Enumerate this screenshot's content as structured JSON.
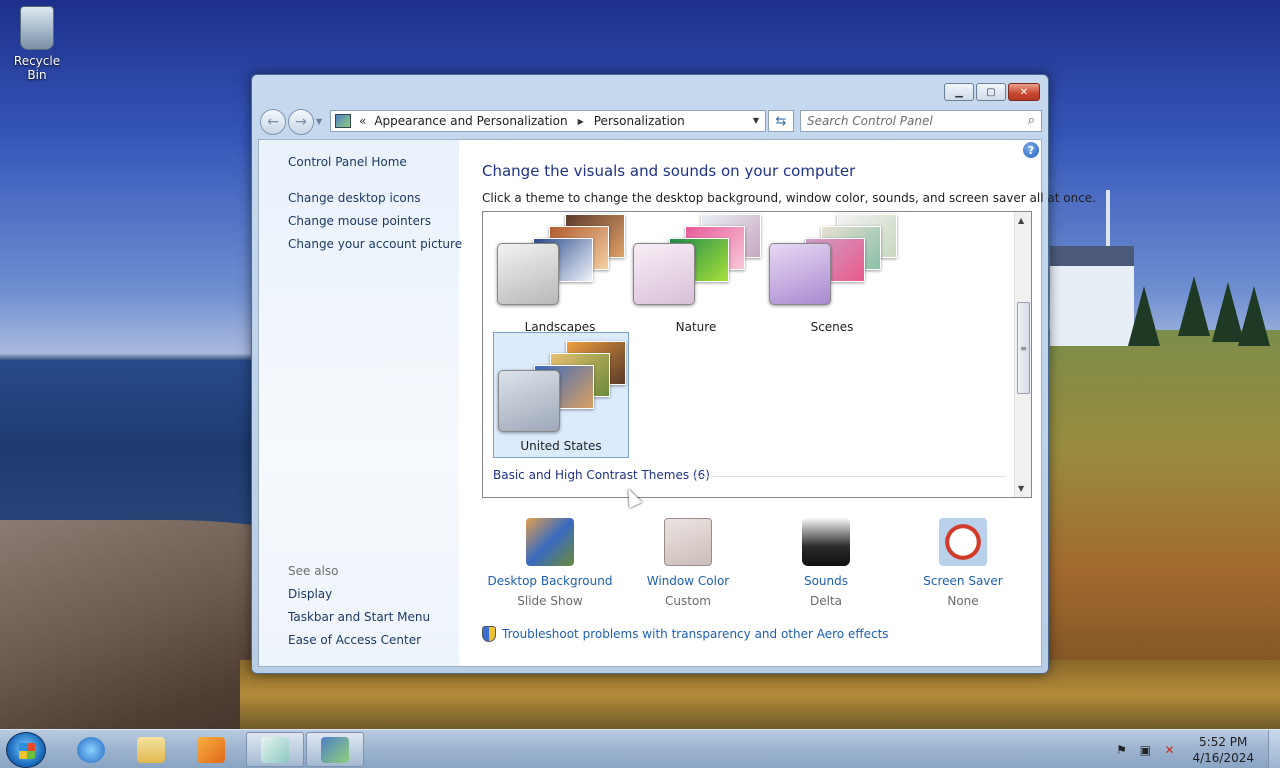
{
  "desktop": {
    "recycle_bin_label": "Recycle Bin"
  },
  "window": {
    "address": {
      "chevrons": "«",
      "crumbs": [
        "Appearance and Personalization",
        "Personalization"
      ]
    },
    "search_placeholder": "Search Control Panel",
    "sidebar": {
      "home": "Control Panel Home",
      "links": [
        "Change desktop icons",
        "Change mouse pointers",
        "Change your account picture"
      ],
      "see_also_label": "See also",
      "see_also": [
        "Display",
        "Taskbar and Start Menu",
        "Ease of Access Center"
      ]
    },
    "heading": "Change the visuals and sounds on your computer",
    "subtext": "Click a theme to change the desktop background, window color, sounds, and screen saver all at once.",
    "themes": [
      {
        "label": "Landscapes",
        "selected": false
      },
      {
        "label": "Nature",
        "selected": false
      },
      {
        "label": "Scenes",
        "selected": false
      },
      {
        "label": "United States",
        "selected": true
      }
    ],
    "group_label": "Basic and High Contrast Themes (6)",
    "bottom": [
      {
        "title": "Desktop Background",
        "sub": "Slide Show",
        "icon": "desktop-background-icon"
      },
      {
        "title": "Window Color",
        "sub": "Custom",
        "icon": "window-color-icon"
      },
      {
        "title": "Sounds",
        "sub": "Delta",
        "icon": "sounds-icon"
      },
      {
        "title": "Screen Saver",
        "sub": "None",
        "icon": "screen-saver-icon"
      }
    ],
    "troubleshoot": "Troubleshoot problems with transparency and other Aero effects"
  },
  "taskbar": {
    "time": "5:52 PM",
    "date": "4/16/2024"
  }
}
